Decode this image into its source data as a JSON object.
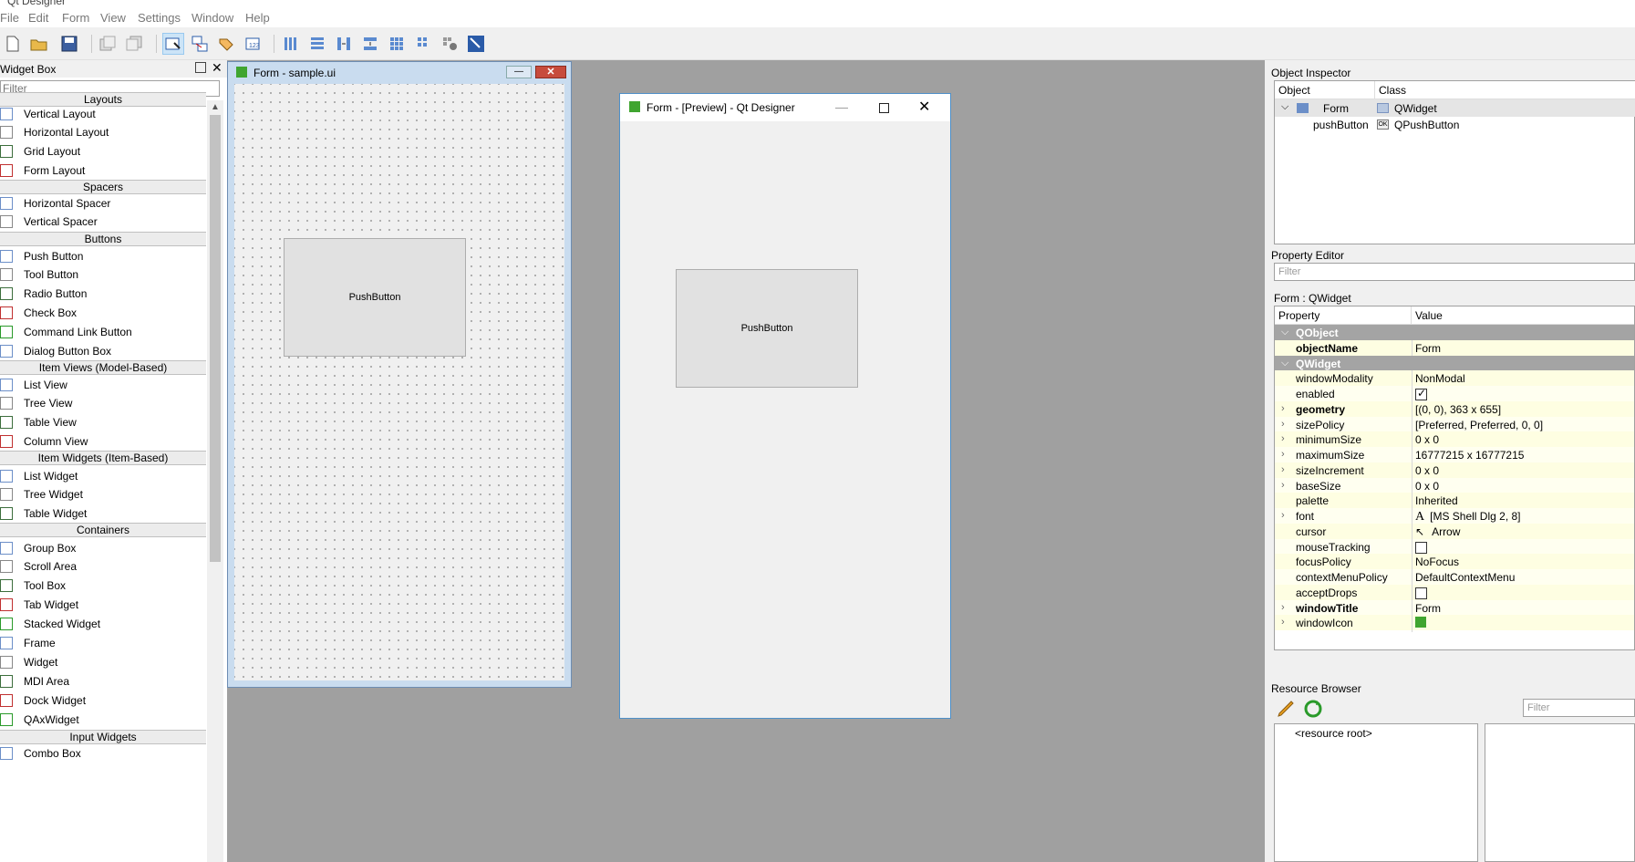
{
  "app": {
    "title": "Qt Designer"
  },
  "menu": [
    "File",
    "Edit",
    "Form",
    "View",
    "Settings",
    "Window",
    "Help"
  ],
  "widget_box": {
    "title": "Widget Box",
    "filter_placeholder": "Filter",
    "categories": {
      "layouts": "Layouts",
      "spacers": "Spacers",
      "buttons": "Buttons",
      "item_views": "Item Views (Model-Based)",
      "item_widgets": "Item Widgets (Item-Based)",
      "containers": "Containers",
      "input_widgets": "Input Widgets"
    },
    "layouts": [
      "Vertical Layout",
      "Horizontal Layout",
      "Grid Layout",
      "Form Layout"
    ],
    "spacers": [
      "Horizontal Spacer",
      "Vertical Spacer"
    ],
    "buttons": [
      "Push Button",
      "Tool Button",
      "Radio Button",
      "Check Box",
      "Command Link Button",
      "Dialog Button Box"
    ],
    "item_views": [
      "List View",
      "Tree View",
      "Table View",
      "Column View"
    ],
    "item_widgets": [
      "List Widget",
      "Tree Widget",
      "Table Widget"
    ],
    "containers": [
      "Group Box",
      "Scroll Area",
      "Tool Box",
      "Tab Widget",
      "Stacked Widget",
      "Frame",
      "Widget",
      "MDI Area",
      "Dock Widget",
      "QAxWidget"
    ],
    "input_widgets": [
      "Combo Box"
    ]
  },
  "form_window": {
    "title": "Form - sample.ui",
    "button_text": "PushButton"
  },
  "preview_window": {
    "title": "Form - [Preview] - Qt Designer",
    "button_text": "PushButton"
  },
  "object_inspector": {
    "title": "Object Inspector",
    "headers": [
      "Object",
      "Class"
    ],
    "rows": [
      {
        "object": "Form",
        "class": "QWidget"
      },
      {
        "object": "pushButton",
        "class": "QPushButton"
      }
    ]
  },
  "property_editor": {
    "title": "Property Editor",
    "filter_placeholder": "Filter",
    "subtitle": "Form : QWidget",
    "headers": [
      "Property",
      "Value"
    ],
    "groups": {
      "qobject": "QObject",
      "qwidget": "QWidget"
    },
    "props": {
      "objectName": "Form",
      "windowModality": "NonModal",
      "enabled": "",
      "geometry": "[(0, 0), 363 x 655]",
      "sizePolicy": "[Preferred, Preferred, 0, 0]",
      "minimumSize": "0 x 0",
      "maximumSize": "16777215 x 16777215",
      "sizeIncrement": "0 x 0",
      "baseSize": "0 x 0",
      "palette": "Inherited",
      "font": "[MS Shell Dlg 2, 8]",
      "cursor": "Arrow",
      "focusPolicy": "NoFocus",
      "contextMenuPolicy": "DefaultContextMenu",
      "windowTitle": "Form"
    },
    "names": [
      "objectName",
      "windowModality",
      "enabled",
      "geometry",
      "sizePolicy",
      "minimumSize",
      "maximumSize",
      "sizeIncrement",
      "baseSize",
      "palette",
      "font",
      "cursor",
      "mouseTracking",
      "focusPolicy",
      "contextMenuPolicy",
      "acceptDrops",
      "windowTitle",
      "windowIcon"
    ],
    "enabled_checked": true,
    "mouseTracking_checked": false,
    "acceptDrops_checked": false
  },
  "resource_browser": {
    "title": "Resource Browser",
    "filter_placeholder": "Filter",
    "root": "<resource root>"
  },
  "colors": {
    "mdi_background": "#a0a0a0",
    "group_row": "#a4a4a4",
    "accent_green": "#40a530"
  }
}
